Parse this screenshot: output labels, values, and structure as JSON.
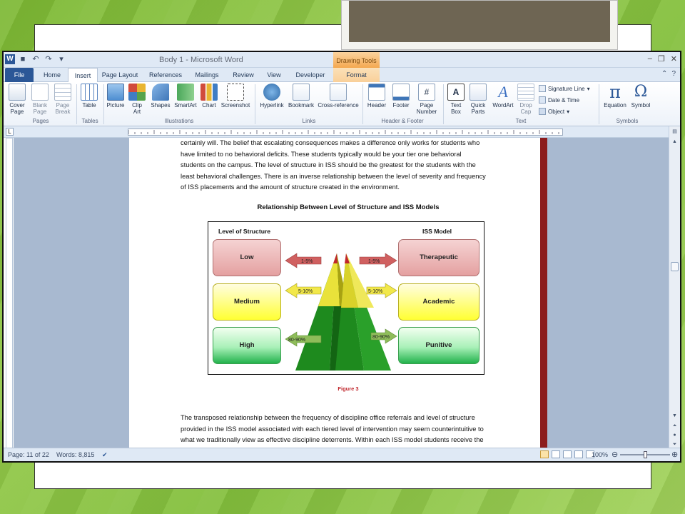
{
  "window": {
    "title": "Body 1 - Microsoft Word",
    "contextual_tab_group": "Drawing Tools"
  },
  "tabs": [
    "File",
    "Home",
    "Insert",
    "Page Layout",
    "References",
    "Mailings",
    "Review",
    "View",
    "Developer",
    "Format"
  ],
  "active_tab": "Insert",
  "ribbon": {
    "pages": {
      "label": "Pages",
      "cover": "Cover\nPage",
      "blank": "Blank\nPage",
      "break": "Page\nBreak"
    },
    "tables": {
      "label": "Tables",
      "table": "Table"
    },
    "illustrations": {
      "label": "Illustrations",
      "picture": "Picture",
      "clipart": "Clip\nArt",
      "shapes": "Shapes",
      "smartart": "SmartArt",
      "chart": "Chart",
      "screenshot": "Screenshot"
    },
    "links": {
      "label": "Links",
      "hyperlink": "Hyperlink",
      "bookmark": "Bookmark",
      "crossref": "Cross-reference"
    },
    "header_footer": {
      "label": "Header & Footer",
      "header": "Header",
      "footer": "Footer",
      "pagenum": "Page\nNumber"
    },
    "text": {
      "label": "Text",
      "textbox": "Text\nBox",
      "quickparts": "Quick\nParts",
      "wordart": "WordArt",
      "dropcap": "Drop\nCap",
      "sigline": "Signature Line",
      "datetime": "Date & Time",
      "object": "Object"
    },
    "symbols": {
      "label": "Symbols",
      "equation": "Equation",
      "symbol": "Symbol"
    }
  },
  "document": {
    "para1": [
      "certainly will.  The belief that escalating consequences makes a difference only works for students who",
      "have limited to no behavioral deficits.  These students typically would be your tier one behavioral",
      "students on the campus.  The level of structure in ISS should be the greatest for the students with the",
      "least behavioral challenges.  There is an inverse relationship between the level of severity and frequency",
      "of ISS placements and the amount of structure created in the environment."
    ],
    "figure_title": "Relationship Between Level of Structure and ISS Models",
    "figure": {
      "left_header": "Level of Structure",
      "right_header": "ISS Model",
      "levels": [
        "Low",
        "Medium",
        "High"
      ],
      "models": [
        "Therapeutic",
        "Academic",
        "Punitive"
      ],
      "percents": [
        "1-5%",
        "5-10%",
        "80-90%"
      ],
      "colors": {
        "low": "#d06060",
        "medium": "#f2e84a",
        "high": "#8fbd5a",
        "pyramid_green": "#1d8a1d",
        "pyramid_yellow": "#e9e23a",
        "pyramid_red": "#c0272d"
      }
    },
    "figure_caption": "Figure 3",
    "para2": [
      "The transposed relationship between the frequency of discipline office referrals and level of structure",
      "provided in the ISS model associated with each tiered level of intervention may seem counterintuitive to",
      "what we traditionally view as effective discipline deterrents.  Within each ISS model students receive the"
    ]
  },
  "status": {
    "page": "Page: 11 of 22",
    "words": "Words: 8,815",
    "zoom": "100%",
    "zoom_level_percent": 100
  }
}
